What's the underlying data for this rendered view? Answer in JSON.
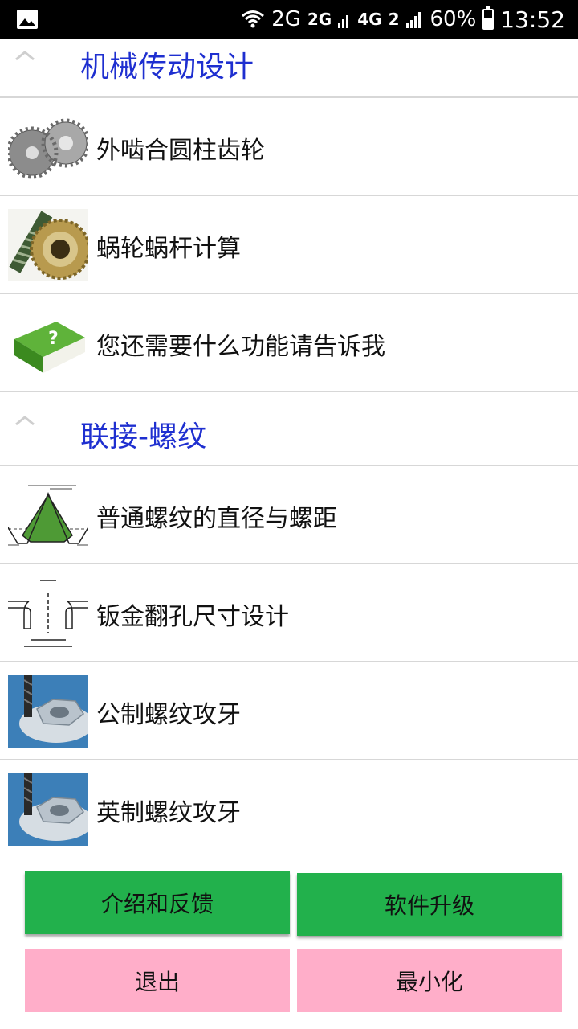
{
  "status_bar": {
    "network_1": "2G",
    "network_2": "2G",
    "network_3": "4G",
    "network_4": "2",
    "battery": "60%",
    "time": "13:52",
    "battery_level": 0.6
  },
  "groups": [
    {
      "title": "机械传动设计",
      "items": [
        {
          "label": "外啮合圆柱齿轮",
          "icon": "spur-gear-icon"
        },
        {
          "label": "蜗轮蜗杆计算",
          "icon": "worm-gear-icon"
        },
        {
          "label": "您还需要什么功能请告诉我",
          "icon": "help-book-icon"
        }
      ]
    },
    {
      "title": "联接-螺纹",
      "items": [
        {
          "label": "普通螺纹的直径与螺距",
          "icon": "thread-profile-icon"
        },
        {
          "label": "钣金翻孔尺寸设计",
          "icon": "flange-hole-drawing-icon"
        },
        {
          "label": "公制螺纹攻牙",
          "icon": "tap-nut-icon"
        },
        {
          "label": "英制螺纹攻牙",
          "icon": "tap-nut-icon"
        }
      ]
    }
  ],
  "buttons": {
    "intro_feedback": "介绍和反馈",
    "upgrade": "软件升级",
    "exit": "退出",
    "minimize": "最小化"
  },
  "colors": {
    "group_title": "#1e2fd0",
    "green_button": "#22b14c",
    "pink_button": "#ffaec9"
  }
}
